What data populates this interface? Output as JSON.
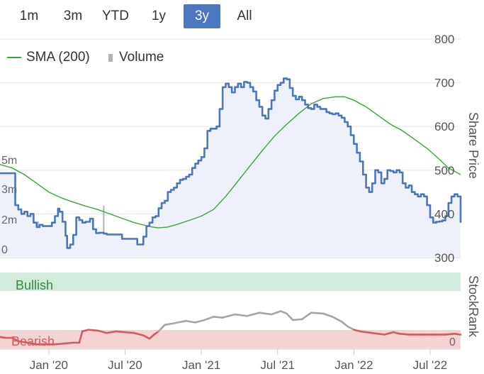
{
  "range_selector": {
    "buttons": [
      "1m",
      "3m",
      "YTD",
      "1y",
      "3y",
      "All"
    ],
    "active": "3y"
  },
  "legend": {
    "sma_label": "SMA (200)",
    "volume_label": "Volume"
  },
  "colors": {
    "price": "#4a77be",
    "sma": "#3aa63a",
    "volume": "#b3b3b3",
    "bullish_band": "#d3ebdc",
    "bearish_band": "#f4d3d5",
    "rank_bearish": "#d65a60",
    "rank_neutral": "#a6a6a6",
    "active_button": "#4a77be"
  },
  "chart_data": {
    "type": "line",
    "x_axis": {
      "tick_labels": [
        "Jan '20",
        "Jul '20",
        "Jan '21",
        "Jul '21",
        "Jan '22",
        "Jul '22"
      ],
      "ticks": [
        2020.0,
        2020.5,
        2021.0,
        2021.5,
        2022.0,
        2022.5
      ],
      "range": [
        2019.68,
        2022.7
      ]
    },
    "price_axis": {
      "title": "Share Price",
      "ticks": [
        300,
        400,
        500,
        600,
        700,
        800
      ],
      "tick_labels": [
        "300",
        "400",
        "500",
        "600",
        "700",
        "800"
      ],
      "range": [
        300,
        800
      ]
    },
    "volume_axis": {
      "ticks": [
        0,
        2,
        3,
        5
      ],
      "tick_labels": [
        "0",
        "2m",
        "3m",
        "5m"
      ]
    },
    "price_series": {
      "name": "Share Price",
      "points": [
        [
          2019.68,
          493
        ],
        [
          2019.76,
          493
        ],
        [
          2019.78,
          420
        ],
        [
          2019.8,
          410
        ],
        [
          2019.82,
          400
        ],
        [
          2019.84,
          405
        ],
        [
          2019.86,
          395
        ],
        [
          2019.88,
          400
        ],
        [
          2019.9,
          380
        ],
        [
          2019.92,
          370
        ],
        [
          2019.94,
          375
        ],
        [
          2019.96,
          372
        ],
        [
          2019.99,
          372
        ],
        [
          2020.02,
          380
        ],
        [
          2020.04,
          395
        ],
        [
          2020.06,
          412
        ],
        [
          2020.07,
          405
        ],
        [
          2020.09,
          382
        ],
        [
          2020.11,
          350
        ],
        [
          2020.12,
          322
        ],
        [
          2020.14,
          330
        ],
        [
          2020.16,
          352
        ],
        [
          2020.18,
          392
        ],
        [
          2020.2,
          386
        ],
        [
          2020.22,
          380
        ],
        [
          2020.24,
          382
        ],
        [
          2020.27,
          389
        ],
        [
          2020.29,
          365
        ],
        [
          2020.31,
          356
        ],
        [
          2020.33,
          357
        ],
        [
          2020.36,
          355
        ],
        [
          2020.38,
          353
        ],
        [
          2020.4,
          353
        ],
        [
          2020.42,
          353
        ],
        [
          2020.44,
          353
        ],
        [
          2020.46,
          353
        ],
        [
          2020.48,
          343
        ],
        [
          2020.5,
          343
        ],
        [
          2020.52,
          343
        ],
        [
          2020.56,
          343
        ],
        [
          2020.58,
          330
        ],
        [
          2020.6,
          330
        ],
        [
          2020.62,
          348
        ],
        [
          2020.64,
          372
        ],
        [
          2020.66,
          380
        ],
        [
          2020.68,
          392
        ],
        [
          2020.7,
          395
        ],
        [
          2020.72,
          413
        ],
        [
          2020.74,
          425
        ],
        [
          2020.76,
          430
        ],
        [
          2020.78,
          450
        ],
        [
          2020.8,
          455
        ],
        [
          2020.82,
          460
        ],
        [
          2020.84,
          470
        ],
        [
          2020.86,
          478
        ],
        [
          2020.88,
          480
        ],
        [
          2020.9,
          485
        ],
        [
          2020.92,
          490
        ],
        [
          2020.94,
          505
        ],
        [
          2020.96,
          515
        ],
        [
          2020.98,
          522
        ],
        [
          2021.0,
          530
        ],
        [
          2021.02,
          550
        ],
        [
          2021.04,
          590
        ],
        [
          2021.06,
          595
        ],
        [
          2021.08,
          595
        ],
        [
          2021.1,
          600
        ],
        [
          2021.12,
          640
        ],
        [
          2021.14,
          690
        ],
        [
          2021.16,
          698
        ],
        [
          2021.18,
          690
        ],
        [
          2021.2,
          678
        ],
        [
          2021.22,
          690
        ],
        [
          2021.24,
          698
        ],
        [
          2021.26,
          690
        ],
        [
          2021.28,
          702
        ],
        [
          2021.3,
          700
        ],
        [
          2021.32,
          690
        ],
        [
          2021.34,
          680
        ],
        [
          2021.36,
          660
        ],
        [
          2021.38,
          645
        ],
        [
          2021.4,
          625
        ],
        [
          2021.42,
          618
        ],
        [
          2021.44,
          640
        ],
        [
          2021.46,
          660
        ],
        [
          2021.48,
          682
        ],
        [
          2021.5,
          695
        ],
        [
          2021.52,
          700
        ],
        [
          2021.54,
          710
        ],
        [
          2021.56,
          708
        ],
        [
          2021.58,
          688
        ],
        [
          2021.6,
          670
        ],
        [
          2021.62,
          662
        ],
        [
          2021.64,
          668
        ],
        [
          2021.66,
          660
        ],
        [
          2021.68,
          650
        ],
        [
          2021.7,
          642
        ],
        [
          2021.72,
          640
        ],
        [
          2021.74,
          650
        ],
        [
          2021.76,
          645
        ],
        [
          2021.78,
          640
        ],
        [
          2021.8,
          640
        ],
        [
          2021.82,
          633
        ],
        [
          2021.84,
          630
        ],
        [
          2021.86,
          628
        ],
        [
          2021.88,
          630
        ],
        [
          2021.9,
          625
        ],
        [
          2021.92,
          620
        ],
        [
          2021.94,
          610
        ],
        [
          2021.96,
          600
        ],
        [
          2021.98,
          580
        ],
        [
          2022.0,
          560
        ],
        [
          2022.02,
          540
        ],
        [
          2022.04,
          520
        ],
        [
          2022.06,
          490
        ],
        [
          2022.08,
          460
        ],
        [
          2022.1,
          450
        ],
        [
          2022.12,
          470
        ],
        [
          2022.14,
          500
        ],
        [
          2022.16,
          495
        ],
        [
          2022.18,
          470
        ],
        [
          2022.2,
          480
        ],
        [
          2022.22,
          500
        ],
        [
          2022.24,
          498
        ],
        [
          2022.26,
          495
        ],
        [
          2022.28,
          500
        ],
        [
          2022.3,
          495
        ],
        [
          2022.32,
          470
        ],
        [
          2022.34,
          460
        ],
        [
          2022.36,
          465
        ],
        [
          2022.38,
          450
        ],
        [
          2022.4,
          445
        ],
        [
          2022.42,
          440
        ],
        [
          2022.44,
          445
        ],
        [
          2022.46,
          440
        ],
        [
          2022.48,
          420
        ],
        [
          2022.5,
          392
        ],
        [
          2022.52,
          380
        ],
        [
          2022.54,
          382
        ],
        [
          2022.56,
          383
        ],
        [
          2022.58,
          385
        ],
        [
          2022.6,
          395
        ],
        [
          2022.62,
          425
        ],
        [
          2022.64,
          440
        ],
        [
          2022.66,
          445
        ],
        [
          2022.68,
          440
        ],
        [
          2022.7,
          380
        ]
      ]
    },
    "sma_series": {
      "name": "SMA (200)",
      "points": [
        [
          2019.68,
          513
        ],
        [
          2019.76,
          505
        ],
        [
          2019.84,
          490
        ],
        [
          2019.92,
          470
        ],
        [
          2020.0,
          450
        ],
        [
          2020.08,
          437
        ],
        [
          2020.16,
          427
        ],
        [
          2020.24,
          418
        ],
        [
          2020.32,
          410
        ],
        [
          2020.4,
          400
        ],
        [
          2020.48,
          390
        ],
        [
          2020.56,
          380
        ],
        [
          2020.64,
          373
        ],
        [
          2020.68,
          370
        ],
        [
          2020.72,
          368
        ],
        [
          2020.78,
          370
        ],
        [
          2020.84,
          376
        ],
        [
          2020.92,
          385
        ],
        [
          2021.0,
          395
        ],
        [
          2021.08,
          410
        ],
        [
          2021.16,
          440
        ],
        [
          2021.24,
          475
        ],
        [
          2021.32,
          510
        ],
        [
          2021.4,
          545
        ],
        [
          2021.48,
          578
        ],
        [
          2021.56,
          605
        ],
        [
          2021.64,
          630
        ],
        [
          2021.72,
          652
        ],
        [
          2021.8,
          664
        ],
        [
          2021.88,
          668
        ],
        [
          2021.94,
          668
        ],
        [
          2022.0,
          660
        ],
        [
          2022.08,
          645
        ],
        [
          2022.16,
          625
        ],
        [
          2022.24,
          605
        ],
        [
          2022.32,
          590
        ],
        [
          2022.4,
          570
        ],
        [
          2022.48,
          550
        ],
        [
          2022.56,
          525
        ],
        [
          2022.62,
          505
        ],
        [
          2022.7,
          490
        ]
      ]
    },
    "volume_series": {
      "name": "Volume",
      "unit": "m",
      "bars": [
        [
          2019.7,
          0.2
        ],
        [
          2019.75,
          0.15
        ],
        [
          2019.8,
          0.2
        ],
        [
          2019.85,
          0.25
        ],
        [
          2019.93,
          2.05
        ],
        [
          2019.95,
          0.3
        ],
        [
          2020.02,
          0.3
        ],
        [
          2020.08,
          0.3
        ],
        [
          2020.15,
          0.3
        ],
        [
          2020.22,
          0.25
        ],
        [
          2020.3,
          0.3
        ],
        [
          2020.36,
          3.0
        ],
        [
          2020.42,
          0.3
        ],
        [
          2020.5,
          0.3
        ],
        [
          2020.58,
          0.3
        ],
        [
          2020.65,
          0.3
        ],
        [
          2020.71,
          0.3
        ],
        [
          2020.74,
          0.5
        ],
        [
          2020.8,
          0.3
        ],
        [
          2020.88,
          0.3
        ],
        [
          2020.96,
          0.3
        ],
        [
          2021.04,
          0.3
        ],
        [
          2021.12,
          0.35
        ],
        [
          2021.2,
          0.3
        ],
        [
          2021.28,
          0.3
        ],
        [
          2021.36,
          0.3
        ],
        [
          2021.44,
          0.35
        ],
        [
          2021.52,
          0.3
        ],
        [
          2021.6,
          0.3
        ],
        [
          2021.68,
          0.3
        ],
        [
          2021.76,
          0.35
        ],
        [
          2021.84,
          0.3
        ],
        [
          2021.92,
          0.3
        ],
        [
          2022.0,
          0.3
        ],
        [
          2022.08,
          0.3
        ],
        [
          2022.16,
          0.35
        ],
        [
          2022.24,
          0.55
        ],
        [
          2022.32,
          0.3
        ],
        [
          2022.4,
          0.3
        ],
        [
          2022.48,
          0.3
        ],
        [
          2022.56,
          0.3
        ],
        [
          2022.64,
          0.3
        ]
      ]
    },
    "stockrank": {
      "title": "StockRank",
      "band_top_label": "Bullish",
      "band_bottom_label": "Bearish",
      "ticks": [
        0
      ],
      "tick_labels": [
        "0"
      ],
      "range": [
        0,
        100
      ],
      "points": [
        [
          2019.68,
          15
        ],
        [
          2019.72,
          14
        ],
        [
          2019.76,
          14
        ],
        [
          2019.8,
          10
        ],
        [
          2019.86,
          8
        ],
        [
          2019.92,
          6
        ],
        [
          2019.98,
          6
        ],
        [
          2020.04,
          6
        ],
        [
          2020.1,
          7
        ],
        [
          2020.16,
          8
        ],
        [
          2020.2,
          8
        ],
        [
          2020.22,
          22
        ],
        [
          2020.26,
          24
        ],
        [
          2020.32,
          23
        ],
        [
          2020.38,
          20
        ],
        [
          2020.44,
          22
        ],
        [
          2020.5,
          21
        ],
        [
          2020.56,
          20
        ],
        [
          2020.62,
          17
        ],
        [
          2020.66,
          13
        ],
        [
          2020.69,
          18
        ],
        [
          2020.72,
          22
        ],
        [
          2020.76,
          30
        ],
        [
          2020.82,
          32
        ],
        [
          2020.9,
          35
        ],
        [
          2020.96,
          33
        ],
        [
          2021.02,
          36
        ],
        [
          2021.08,
          40
        ],
        [
          2021.14,
          39
        ],
        [
          2021.22,
          43
        ],
        [
          2021.3,
          41
        ],
        [
          2021.38,
          45
        ],
        [
          2021.46,
          43
        ],
        [
          2021.52,
          47
        ],
        [
          2021.56,
          44
        ],
        [
          2021.6,
          36
        ],
        [
          2021.66,
          37
        ],
        [
          2021.72,
          45
        ],
        [
          2021.8,
          44
        ],
        [
          2021.86,
          40
        ],
        [
          2021.92,
          34
        ],
        [
          2021.96,
          28
        ],
        [
          2022.0,
          24
        ],
        [
          2022.04,
          22
        ],
        [
          2022.12,
          20
        ],
        [
          2022.2,
          18
        ],
        [
          2022.26,
          21
        ],
        [
          2022.3,
          19
        ],
        [
          2022.36,
          18
        ],
        [
          2022.44,
          18
        ],
        [
          2022.52,
          18
        ],
        [
          2022.6,
          18
        ],
        [
          2022.66,
          19
        ],
        [
          2022.7,
          18
        ]
      ],
      "bearish_threshold": 24
    }
  }
}
